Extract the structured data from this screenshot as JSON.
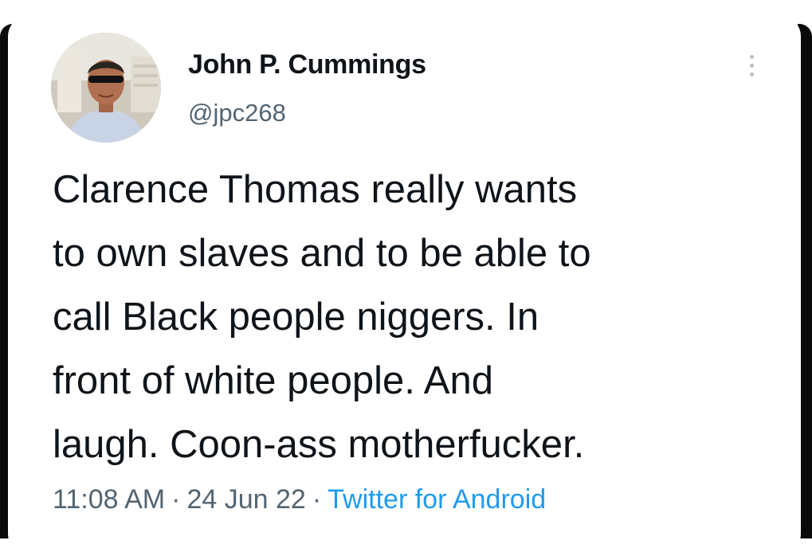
{
  "tweet": {
    "display_name": "John P. Cummings",
    "handle": "@jpc268",
    "text_lines": [
      "Clarence Thomas really wants",
      "to own slaves and to be able to",
      "call Black people niggers. In",
      "front of white people. And",
      "laugh. Coon-ass motherfucker."
    ],
    "time": "11:08 AM",
    "date": "24 Jun 22",
    "separator": "·",
    "source": "Twitter for Android"
  },
  "icons": {
    "more": "more-vertical-icon",
    "avatar": "avatar-photo"
  },
  "colors": {
    "text_primary": "#0f1419",
    "text_secondary": "#536471",
    "link": "#1d9bf0",
    "frame": "#0a0a0a"
  }
}
